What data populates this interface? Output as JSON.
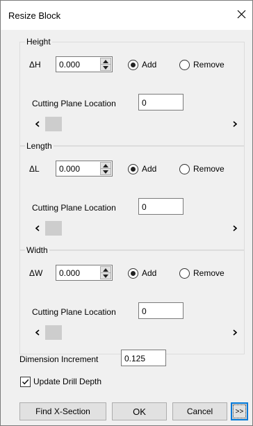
{
  "window": {
    "title": "Resize Block"
  },
  "groups": [
    {
      "label": "Height",
      "delta_label": "ΔH",
      "delta_value": "0.000",
      "operation": {
        "add_label": "Add",
        "remove_label": "Remove",
        "selected": "Add"
      },
      "cutting_plane_label": "Cutting Plane Location",
      "cutting_plane_value": "0"
    },
    {
      "label": "Length",
      "delta_label": "ΔL",
      "delta_value": "0.000",
      "operation": {
        "add_label": "Add",
        "remove_label": "Remove",
        "selected": "Add"
      },
      "cutting_plane_label": "Cutting Plane Location",
      "cutting_plane_value": "0"
    },
    {
      "label": "Width",
      "delta_label": "ΔW",
      "delta_value": "0.000",
      "operation": {
        "add_label": "Add",
        "remove_label": "Remove",
        "selected": "Add"
      },
      "cutting_plane_label": "Cutting Plane Location",
      "cutting_plane_value": "0"
    }
  ],
  "dimension_increment": {
    "label": "Dimension Increment",
    "value": "0.125"
  },
  "update_drill_depth": {
    "label": "Update Drill Depth",
    "checked": true
  },
  "buttons": {
    "find_x_section": "Find X-Section",
    "ok": "OK",
    "cancel": "Cancel",
    "more": ">>"
  },
  "colors": {
    "dialog_background": "#f0f0f0",
    "focus_border": "#0078d7"
  }
}
